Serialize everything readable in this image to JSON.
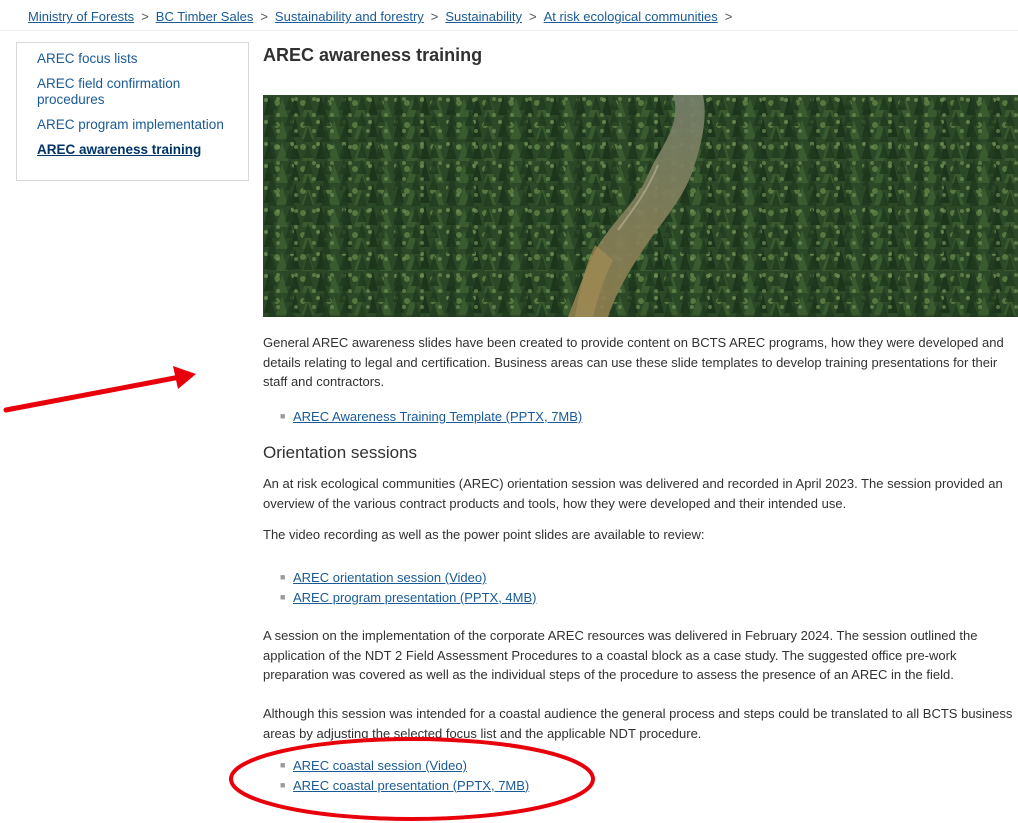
{
  "breadcrumb": {
    "items": [
      "Ministry of Forests",
      "BC Timber Sales",
      "Sustainability and forestry",
      "Sustainability",
      "At risk ecological communities"
    ],
    "separator": ">"
  },
  "sidebar": {
    "items": [
      {
        "label": "AREC focus lists"
      },
      {
        "label": "AREC field confirmation procedures"
      },
      {
        "label": "AREC program implementation"
      },
      {
        "label": "AREC awareness training",
        "active": true
      }
    ]
  },
  "main": {
    "title": "AREC awareness training",
    "intro": "General AREC awareness slides have been created to provide content on BCTS AREC programs, how they were developed and details relating to legal and certification. Business areas can use these slide templates to develop training presentations for their staff and contractors.",
    "template_link": "AREC Awareness Training Template (PPTX, 7MB)",
    "orientation_heading": "Orientation sessions",
    "orientation_para": "An at risk ecological communities (AREC) orientation session was delivered and recorded in April 2023. The session provided an overview of the various contract products and tools, how they were developed and their intended use.",
    "review_para": "The video recording as well as the power point slides are available to review:",
    "orientation_links": [
      "AREC orientation session (Video)",
      "AREC program presentation (PPTX, 4MB)"
    ],
    "implementation_para": "A session on the implementation of the corporate AREC resources was delivered in February 2024. The session outlined the application of the NDT 2 Field Assessment Procedures to a coastal block as a case study. The suggested office pre-work preparation was covered as well as the individual steps of the procedure to assess the presence of an AREC in the field.",
    "coastal_para": "Although this session was intended for a coastal audience the general process and steps could be translated to all BCTS business areas by adjusting the selected focus list and the applicable NDT procedure.",
    "coastal_links": [
      "AREC coastal session (Video)",
      "AREC coastal presentation (PPTX, 7MB)"
    ]
  },
  "icons": {
    "bullet": "square-bullet-icon",
    "annotation_arrow": "red-arrow-icon",
    "annotation_circle": "red-ellipse-icon"
  },
  "colors": {
    "link": "#1a5a96",
    "active_link": "#003366",
    "annotation": "#e8000b"
  }
}
